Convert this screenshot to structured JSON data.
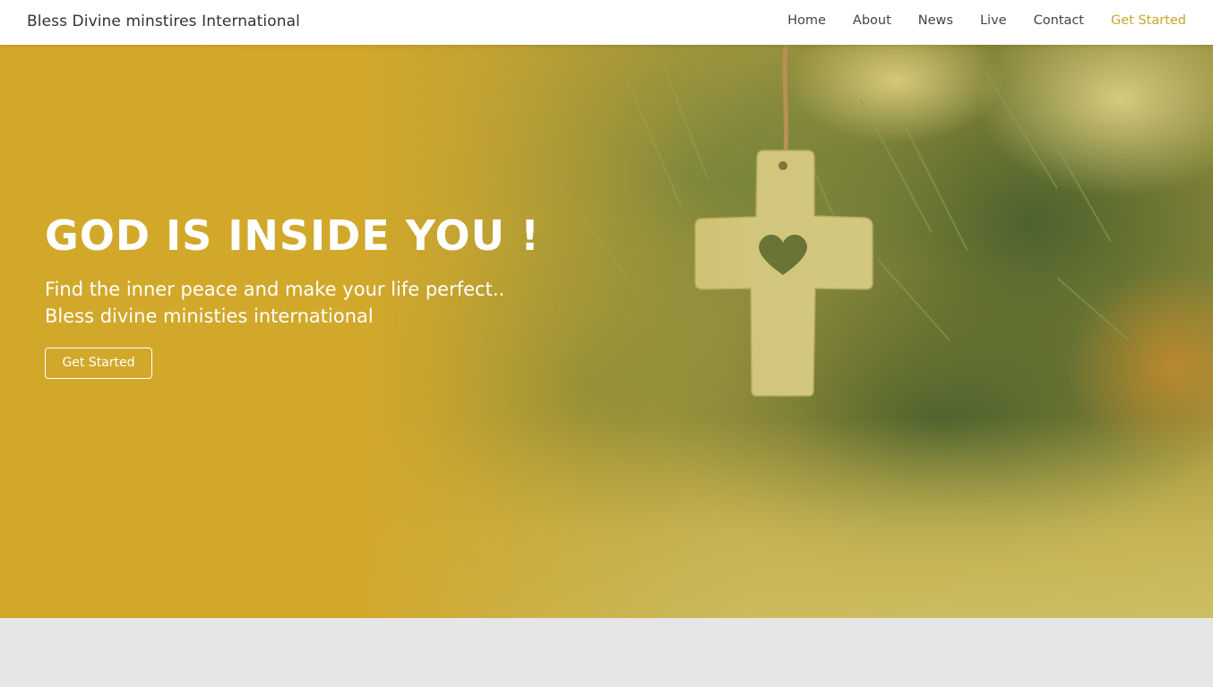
{
  "header": {
    "brand": "Bless Divine minstires International",
    "nav": [
      {
        "label": "Home"
      },
      {
        "label": "About"
      },
      {
        "label": "News"
      },
      {
        "label": "Live"
      },
      {
        "label": "Contact"
      },
      {
        "label": "Get Started"
      }
    ],
    "accent_color": "#c9a52e"
  },
  "hero": {
    "title": "GOD IS INSIDE YOU !",
    "subtitle_line1": "Find the inner peace and make your life perfect..",
    "subtitle_line2": "Bless divine ministies international",
    "button_label": "Get Started",
    "overlay_color": "#d4ab2e",
    "image": "cross-with-heart-cutout"
  }
}
